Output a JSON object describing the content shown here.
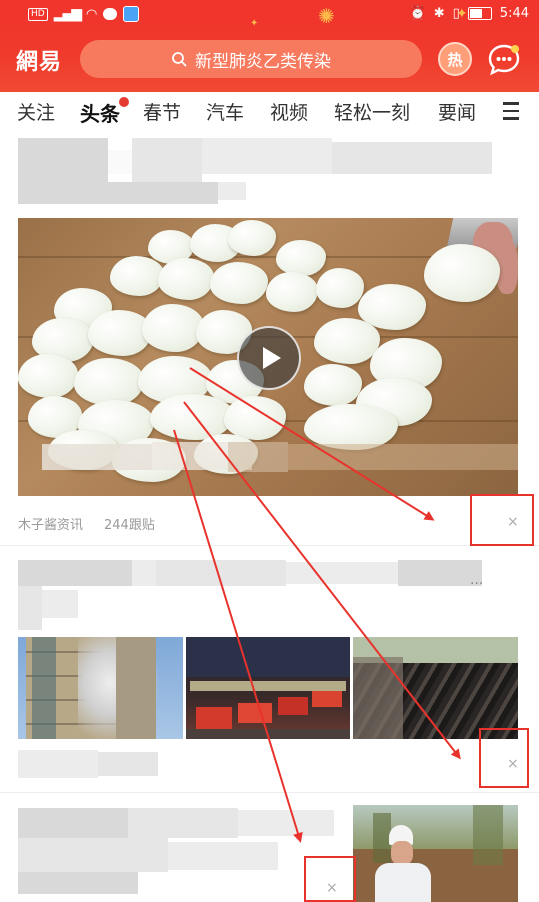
{
  "status_bar": {
    "hd": "HD",
    "time": "5:44"
  },
  "header": {
    "brand": "網易",
    "search_placeholder": "新型肺炎乙类传染",
    "hot_label": "热"
  },
  "tabs": [
    {
      "label": "关注"
    },
    {
      "label": "头条",
      "active": true,
      "has_dot": true
    },
    {
      "label": "春节"
    },
    {
      "label": "汽车"
    },
    {
      "label": "视频"
    },
    {
      "label": "轻松一刻"
    },
    {
      "label": "要闻"
    }
  ],
  "feed": {
    "video_item": {
      "source": "木子酱资讯",
      "comments": "244跟贴",
      "close": "×"
    },
    "photo_item": {
      "more": "...",
      "close": "×"
    },
    "third_item": {
      "close": "×"
    }
  },
  "colors": {
    "brand_red": "#ef3a2c",
    "annotation_red": "#e8332c"
  }
}
